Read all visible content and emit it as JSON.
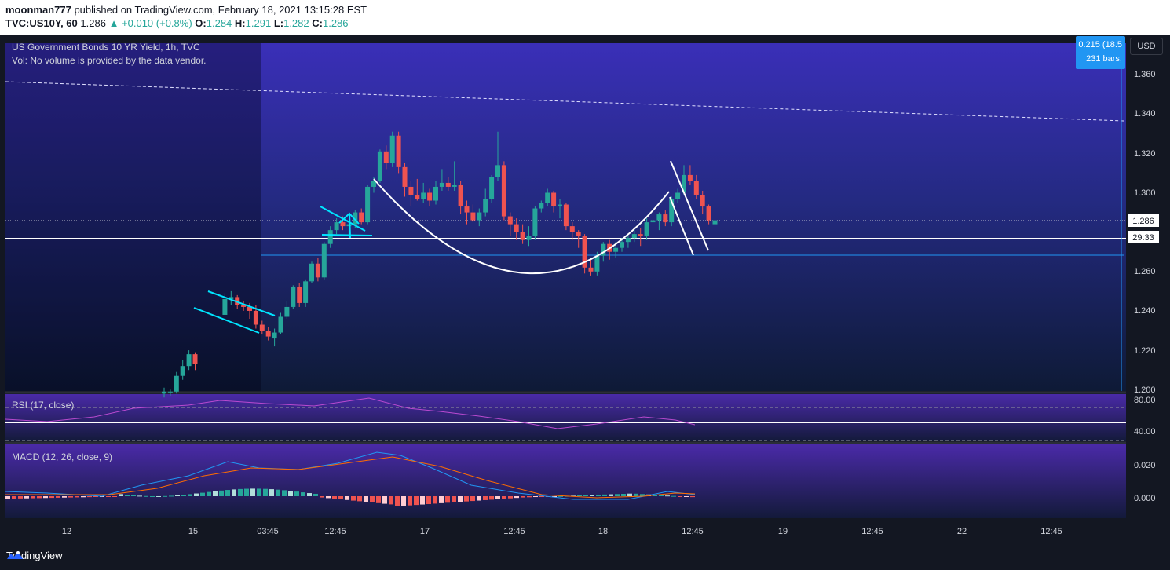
{
  "publish": {
    "author": "moonman777",
    "text": "published on TradingView.com, February 18, 2021 13:15:28 EST"
  },
  "ohlc": {
    "symbol": "TVC:US10Y, 60",
    "last": "1.286",
    "change": "▲ +0.010 (+0.8%)",
    "o_label": "O:",
    "o": "1.284",
    "h_label": "H:",
    "h": "1.291",
    "l_label": "L:",
    "l": "1.282",
    "c_label": "C:",
    "c": "1.286"
  },
  "legend": {
    "title": "US Government Bonds 10 YR Yield, 1h, TVC",
    "vol": "Vol: No volume is provided by the data vendor.",
    "rsi": "RSI (17, close)",
    "macd": "MACD (12, 26, close, 9)"
  },
  "measure": {
    "line1": "0.215 (18.5",
    "line2": "231 bars,"
  },
  "currency": "USD",
  "price_axis": {
    "ticks": [
      "1.360",
      "1.340",
      "1.320",
      "1.300",
      "1.260",
      "1.240",
      "1.220",
      "1.200"
    ],
    "last_price_label": "1.286",
    "countdown_label": "29:33"
  },
  "rsi_axis": {
    "ticks": [
      "80.00",
      "40.00"
    ]
  },
  "macd_axis": {
    "ticks": [
      "0.020",
      "0.000"
    ]
  },
  "time_axis": {
    "ticks": [
      "12",
      "15",
      "03:45",
      "12:45",
      "17",
      "12:45",
      "18",
      "12:45",
      "19",
      "12:45",
      "22",
      "12:45"
    ]
  },
  "branding": "TradingView",
  "colors": {
    "up": "#26a69a",
    "down": "#ef5350",
    "drawing_cyan": "#00e5ff",
    "drawing_white": "#ffffff",
    "measure_fill": "#2196f3"
  },
  "chart_data": {
    "type": "candlestick",
    "title": "US Government Bonds 10 YR Yield, 1h, TVC",
    "ylim": [
      1.2,
      1.368
    ],
    "candles": [
      {
        "o": 1.198,
        "h": 1.201,
        "l": 1.196,
        "c": 1.199
      },
      {
        "o": 1.199,
        "h": 1.2,
        "l": 1.197,
        "c": 1.199
      },
      {
        "o": 1.199,
        "h": 1.209,
        "l": 1.198,
        "c": 1.207
      },
      {
        "o": 1.207,
        "h": 1.215,
        "l": 1.205,
        "c": 1.212
      },
      {
        "o": 1.212,
        "h": 1.22,
        "l": 1.21,
        "c": 1.218
      },
      {
        "o": 1.218,
        "h": 1.219,
        "l": 1.21,
        "c": 1.213
      },
      {
        "o": 1.238,
        "h": 1.249,
        "l": 1.238,
        "c": 1.246
      },
      {
        "o": 1.246,
        "h": 1.25,
        "l": 1.243,
        "c": 1.247
      },
      {
        "o": 1.247,
        "h": 1.248,
        "l": 1.241,
        "c": 1.243
      },
      {
        "o": 1.243,
        "h": 1.245,
        "l": 1.24,
        "c": 1.242
      },
      {
        "o": 1.242,
        "h": 1.244,
        "l": 1.236,
        "c": 1.24
      },
      {
        "o": 1.24,
        "h": 1.243,
        "l": 1.231,
        "c": 1.233
      },
      {
        "o": 1.233,
        "h": 1.235,
        "l": 1.228,
        "c": 1.23
      },
      {
        "o": 1.23,
        "h": 1.232,
        "l": 1.225,
        "c": 1.227
      },
      {
        "o": 1.226,
        "h": 1.231,
        "l": 1.222,
        "c": 1.229
      },
      {
        "o": 1.229,
        "h": 1.239,
        "l": 1.228,
        "c": 1.237
      },
      {
        "o": 1.237,
        "h": 1.245,
        "l": 1.236,
        "c": 1.242
      },
      {
        "o": 1.242,
        "h": 1.253,
        "l": 1.241,
        "c": 1.252
      },
      {
        "o": 1.252,
        "h": 1.254,
        "l": 1.242,
        "c": 1.244
      },
      {
        "o": 1.244,
        "h": 1.256,
        "l": 1.242,
        "c": 1.255
      },
      {
        "o": 1.255,
        "h": 1.265,
        "l": 1.254,
        "c": 1.264
      },
      {
        "o": 1.264,
        "h": 1.267,
        "l": 1.255,
        "c": 1.257
      },
      {
        "o": 1.257,
        "h": 1.275,
        "l": 1.256,
        "c": 1.274
      },
      {
        "o": 1.274,
        "h": 1.283,
        "l": 1.272,
        "c": 1.281
      },
      {
        "o": 1.281,
        "h": 1.287,
        "l": 1.279,
        "c": 1.285
      },
      {
        "o": 1.285,
        "h": 1.288,
        "l": 1.281,
        "c": 1.283
      },
      {
        "o": 1.283,
        "h": 1.286,
        "l": 1.279,
        "c": 1.284
      },
      {
        "o": 1.284,
        "h": 1.291,
        "l": 1.282,
        "c": 1.29
      },
      {
        "o": 1.29,
        "h": 1.292,
        "l": 1.284,
        "c": 1.285
      },
      {
        "o": 1.285,
        "h": 1.304,
        "l": 1.284,
        "c": 1.303
      },
      {
        "o": 1.303,
        "h": 1.308,
        "l": 1.3,
        "c": 1.306
      },
      {
        "o": 1.306,
        "h": 1.322,
        "l": 1.305,
        "c": 1.321
      },
      {
        "o": 1.321,
        "h": 1.324,
        "l": 1.312,
        "c": 1.315
      },
      {
        "o": 1.315,
        "h": 1.331,
        "l": 1.313,
        "c": 1.329
      },
      {
        "o": 1.329,
        "h": 1.331,
        "l": 1.31,
        "c": 1.313
      },
      {
        "o": 1.313,
        "h": 1.315,
        "l": 1.298,
        "c": 1.303
      },
      {
        "o": 1.303,
        "h": 1.306,
        "l": 1.293,
        "c": 1.299
      },
      {
        "o": 1.299,
        "h": 1.307,
        "l": 1.296,
        "c": 1.297
      },
      {
        "o": 1.297,
        "h": 1.305,
        "l": 1.295,
        "c": 1.3
      },
      {
        "o": 1.3,
        "h": 1.302,
        "l": 1.293,
        "c": 1.296
      },
      {
        "o": 1.296,
        "h": 1.306,
        "l": 1.294,
        "c": 1.303
      },
      {
        "o": 1.303,
        "h": 1.312,
        "l": 1.301,
        "c": 1.305
      },
      {
        "o": 1.305,
        "h": 1.308,
        "l": 1.301,
        "c": 1.303
      },
      {
        "o": 1.303,
        "h": 1.316,
        "l": 1.301,
        "c": 1.304
      },
      {
        "o": 1.304,
        "h": 1.306,
        "l": 1.289,
        "c": 1.293
      },
      {
        "o": 1.293,
        "h": 1.296,
        "l": 1.284,
        "c": 1.29
      },
      {
        "o": 1.29,
        "h": 1.294,
        "l": 1.285,
        "c": 1.286
      },
      {
        "o": 1.286,
        "h": 1.292,
        "l": 1.283,
        "c": 1.29
      },
      {
        "o": 1.29,
        "h": 1.302,
        "l": 1.288,
        "c": 1.297
      },
      {
        "o": 1.297,
        "h": 1.309,
        "l": 1.295,
        "c": 1.308
      },
      {
        "o": 1.308,
        "h": 1.331,
        "l": 1.306,
        "c": 1.314
      },
      {
        "o": 1.314,
        "h": 1.316,
        "l": 1.286,
        "c": 1.288
      },
      {
        "o": 1.288,
        "h": 1.29,
        "l": 1.278,
        "c": 1.284
      },
      {
        "o": 1.284,
        "h": 1.287,
        "l": 1.276,
        "c": 1.28
      },
      {
        "o": 1.28,
        "h": 1.284,
        "l": 1.274,
        "c": 1.276
      },
      {
        "o": 1.276,
        "h": 1.283,
        "l": 1.273,
        "c": 1.278
      },
      {
        "o": 1.278,
        "h": 1.293,
        "l": 1.276,
        "c": 1.292
      },
      {
        "o": 1.292,
        "h": 1.296,
        "l": 1.29,
        "c": 1.295
      },
      {
        "o": 1.295,
        "h": 1.302,
        "l": 1.293,
        "c": 1.3
      },
      {
        "o": 1.3,
        "h": 1.301,
        "l": 1.29,
        "c": 1.293
      },
      {
        "o": 1.293,
        "h": 1.297,
        "l": 1.287,
        "c": 1.294
      },
      {
        "o": 1.294,
        "h": 1.295,
        "l": 1.281,
        "c": 1.283
      },
      {
        "o": 1.283,
        "h": 1.285,
        "l": 1.276,
        "c": 1.28
      },
      {
        "o": 1.28,
        "h": 1.281,
        "l": 1.272,
        "c": 1.278
      },
      {
        "o": 1.278,
        "h": 1.279,
        "l": 1.259,
        "c": 1.262
      },
      {
        "o": 1.262,
        "h": 1.266,
        "l": 1.258,
        "c": 1.26
      },
      {
        "o": 1.26,
        "h": 1.27,
        "l": 1.258,
        "c": 1.268
      },
      {
        "o": 1.268,
        "h": 1.275,
        "l": 1.265,
        "c": 1.274
      },
      {
        "o": 1.274,
        "h": 1.276,
        "l": 1.266,
        "c": 1.27
      },
      {
        "o": 1.27,
        "h": 1.275,
        "l": 1.267,
        "c": 1.272
      },
      {
        "o": 1.272,
        "h": 1.277,
        "l": 1.27,
        "c": 1.275
      },
      {
        "o": 1.275,
        "h": 1.278,
        "l": 1.272,
        "c": 1.277
      },
      {
        "o": 1.277,
        "h": 1.281,
        "l": 1.275,
        "c": 1.279
      },
      {
        "o": 1.279,
        "h": 1.282,
        "l": 1.273,
        "c": 1.278
      },
      {
        "o": 1.278,
        "h": 1.287,
        "l": 1.276,
        "c": 1.285
      },
      {
        "o": 1.285,
        "h": 1.288,
        "l": 1.283,
        "c": 1.286
      },
      {
        "o": 1.286,
        "h": 1.29,
        "l": 1.281,
        "c": 1.289
      },
      {
        "o": 1.289,
        "h": 1.291,
        "l": 1.283,
        "c": 1.285
      },
      {
        "o": 1.285,
        "h": 1.298,
        "l": 1.283,
        "c": 1.297
      },
      {
        "o": 1.297,
        "h": 1.302,
        "l": 1.295,
        "c": 1.3
      },
      {
        "o": 1.3,
        "h": 1.314,
        "l": 1.299,
        "c": 1.309
      },
      {
        "o": 1.309,
        "h": 1.314,
        "l": 1.304,
        "c": 1.306
      },
      {
        "o": 1.306,
        "h": 1.309,
        "l": 1.297,
        "c": 1.299
      },
      {
        "o": 1.299,
        "h": 1.301,
        "l": 1.289,
        "c": 1.293
      },
      {
        "o": 1.293,
        "h": 1.294,
        "l": 1.284,
        "c": 1.286
      },
      {
        "o": 1.284,
        "h": 1.291,
        "l": 1.282,
        "c": 1.286
      }
    ]
  }
}
